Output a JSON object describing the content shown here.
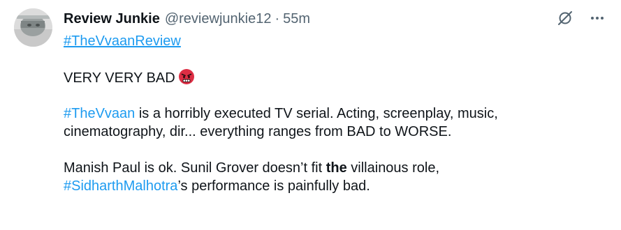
{
  "author": {
    "display_name": "Review Junkie",
    "handle": "@reviewjunkie12",
    "separator": "·",
    "time": "55m"
  },
  "icons": {
    "grok": "grok-icon",
    "more": "more-options-icon",
    "emoji": "angry-face-emoji"
  },
  "tweet": {
    "top_hashtag": "#TheVvaanReview",
    "line_bad": "VERY VERY BAD",
    "p2_hashtag": "#TheVvaan",
    "p2_text": " is a horribly executed TV serial. Acting, screenplay, music,",
    "p2_line2": "cinematography, dir... everything ranges from BAD to WORSE.",
    "p3_text_a": "Manish Paul is ok. Sunil Grover doesn’t fit ",
    "p3_bold": "the",
    "p3_text_b": " villainous role,",
    "p3_hashtag": "#SidharthMalhotra",
    "p3_text_c": "’s performance is painfully bad."
  },
  "colors": {
    "link": "#1d9bf0",
    "text": "#0f1419",
    "muted": "#536471"
  }
}
